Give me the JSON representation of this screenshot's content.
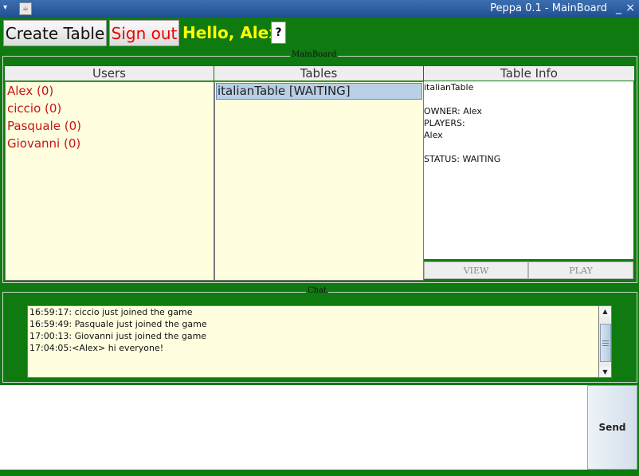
{
  "window": {
    "title": "Peppa 0.1 - MainBoard",
    "app_icon": "java-cup-icon",
    "minimize": "_",
    "close": "×"
  },
  "toolbar": {
    "create_table": "Create Table",
    "sign_out": "Sign out",
    "greeting": "Hello, Alex",
    "help": "?"
  },
  "colors": {
    "background": "#0f7a0f",
    "greeting": "#ffff00",
    "user_text": "#c61414",
    "list_bg": "#ffffe0",
    "selected_row": "#b8cfe5"
  },
  "mainboard": {
    "title": "MainBoard",
    "users_header": "Users",
    "tables_header": "Tables",
    "info_header": "Table Info",
    "users": [
      "Alex (0)",
      "ciccio (0)",
      "Pasquale (0)",
      "Giovanni (0)"
    ],
    "tables": [
      "italianTable [WAITING]"
    ],
    "info_lines": [
      "italianTable",
      "",
      "OWNER: Alex",
      "PLAYERS:",
      "Alex",
      "",
      "STATUS: WAITING"
    ],
    "view_button": "VIEW",
    "play_button": "PLAY"
  },
  "chat": {
    "title": "Chat",
    "messages": [
      "16:59:17: ciccio just joined the game",
      "16:59:49: Pasquale just joined the game",
      "17:00:13: Giovanni just joined the game",
      "17:04:05:<Alex> hi everyone!"
    ],
    "input_value": "",
    "send_button": "Send"
  }
}
